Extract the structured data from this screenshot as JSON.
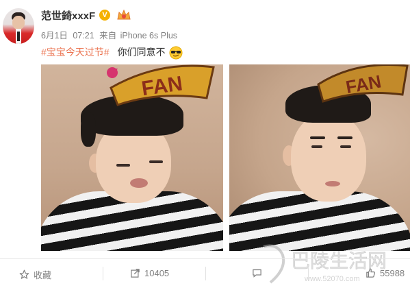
{
  "post": {
    "username": "范世錡xxxF",
    "verified_badge": "V",
    "date": "6月1日",
    "time": "07:21",
    "source_prefix": "来自",
    "source": "iPhone 6s Plus",
    "hashtag": "#宝宝今天过节#",
    "text": "你们同意不",
    "emoji": "sunglasses-emoji"
  },
  "photos": [
    {
      "name": "selfie-pouting",
      "headband_text": "FAN"
    },
    {
      "name": "selfie-frowning",
      "headband_text": "FAN"
    }
  ],
  "actions": {
    "favorite_label": "收藏",
    "share_count": "10405",
    "like_count": "55988"
  },
  "watermark": {
    "text": "巴陵生活网",
    "url": "www.52070.com"
  },
  "colors": {
    "hashtag": "#eb7350",
    "username": "#333333",
    "meta": "#808080",
    "badge": "#f5b100"
  }
}
